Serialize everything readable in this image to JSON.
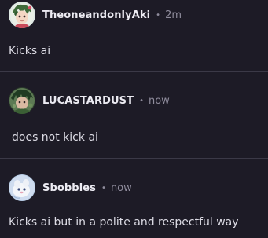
{
  "posts": [
    {
      "avatar_icon": "anime-character-avatar-icon",
      "username": "TheoneandonlyAki",
      "separator": "•",
      "time": "2m",
      "text": "Kicks ai"
    },
    {
      "avatar_icon": "green-character-avatar-icon",
      "username": "LUCASTARDUST",
      "separator": "•",
      "time": "now",
      "text": "does not kick ai"
    },
    {
      "avatar_icon": "white-creature-avatar-icon",
      "username": "Sbobbles",
      "separator": "•",
      "time": "now",
      "text": "Kicks ai but in a polite and respectful way"
    }
  ],
  "colors": {
    "background": "#1d1b26",
    "username": "#ecebf2",
    "meta": "#8f8c9c",
    "body_text": "#dddce5",
    "divider": "#3b3947"
  }
}
